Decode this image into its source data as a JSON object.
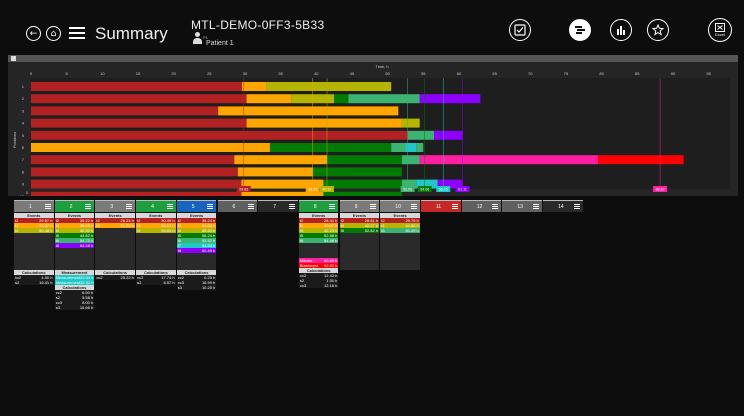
{
  "header": {
    "title": "Summary",
    "device_id": "MTL-DEMO-0FF3-5B33",
    "patient_id": "P1",
    "patient_name": "Patient 1",
    "excel_label": "Excel"
  },
  "colors": {
    "red": "#b22222",
    "orange": "#ffa500",
    "olive": "#b5b400",
    "darkgreen": "#007a00",
    "seagreen": "#3cb371",
    "teal": "#1fc8c8",
    "violet": "#8b00ff",
    "pink": "#ff1fa0",
    "brightred": "#ff0000",
    "blue": "#1565c0"
  },
  "chart_data": {
    "type": "bar",
    "title": "Time, h",
    "xlabel": "Time, h",
    "ylabel": "Positions",
    "xlim": [
      0,
      98
    ],
    "xticks": [
      0,
      5,
      10,
      15,
      20,
      25,
      30,
      35,
      40,
      45,
      50,
      55,
      60,
      65,
      70,
      75,
      80,
      85,
      90,
      95
    ],
    "categories": [
      "1",
      "2",
      "3",
      "4",
      "5",
      "6",
      "7",
      "8",
      "9",
      "10",
      "11",
      "12",
      "13",
      "14"
    ],
    "rows": [
      {
        "position": "1",
        "segments": [
          {
            "start": 0,
            "end": 29.57,
            "color": "red"
          },
          {
            "start": 29.57,
            "end": 33,
            "color": "orange"
          },
          {
            "start": 33,
            "end": 50.5,
            "color": "olive"
          }
        ]
      },
      {
        "position": "2",
        "segments": [
          {
            "start": 0,
            "end": 30.22,
            "color": "red"
          },
          {
            "start": 30.22,
            "end": 36.5,
            "color": "orange"
          },
          {
            "start": 36.5,
            "end": 42.5,
            "color": "olive"
          },
          {
            "start": 42.5,
            "end": 44.5,
            "color": "darkgreen"
          },
          {
            "start": 44.5,
            "end": 54.5,
            "color": "seagreen"
          },
          {
            "start": 54.5,
            "end": 63,
            "color": "violet"
          }
        ]
      },
      {
        "position": "3",
        "segments": [
          {
            "start": 0,
            "end": 26.24,
            "color": "red"
          },
          {
            "start": 26.24,
            "end": 51.5,
            "color": "orange"
          }
        ]
      },
      {
        "position": "4",
        "segments": [
          {
            "start": 0,
            "end": 30.22,
            "color": "red"
          },
          {
            "start": 30.22,
            "end": 52,
            "color": "orange"
          },
          {
            "start": 52,
            "end": 54.5,
            "color": "olive"
          }
        ]
      },
      {
        "position": "5",
        "segments": [
          {
            "start": 0,
            "end": 52.8,
            "color": "red"
          },
          {
            "start": 52.8,
            "end": 56.5,
            "color": "seagreen"
          },
          {
            "start": 56.5,
            "end": 60.5,
            "color": "violet"
          }
        ]
      },
      {
        "position": "6",
        "segments": [
          {
            "start": 0,
            "end": 33.5,
            "color": "orange"
          },
          {
            "start": 33.5,
            "end": 42,
            "color": "darkgreen"
          },
          {
            "start": 42,
            "end": 50.5,
            "color": "darkgreen"
          },
          {
            "start": 50.5,
            "end": 52.5,
            "color": "seagreen"
          },
          {
            "start": 52.5,
            "end": 54,
            "color": "teal"
          },
          {
            "start": 54,
            "end": 55,
            "color": "seagreen"
          }
        ]
      },
      {
        "position": "7",
        "segments": [
          {
            "start": 0,
            "end": 28.5,
            "color": "red"
          },
          {
            "start": 28.5,
            "end": 41.5,
            "color": "orange"
          },
          {
            "start": 41.5,
            "end": 52,
            "color": "darkgreen"
          },
          {
            "start": 52,
            "end": 54.5,
            "color": "seagreen"
          },
          {
            "start": 54.5,
            "end": 79.5,
            "color": "pink"
          },
          {
            "start": 79.5,
            "end": 91.5,
            "color": "brightred"
          }
        ]
      },
      {
        "position": "8",
        "segments": [
          {
            "start": 0,
            "end": 29.0,
            "color": "red"
          },
          {
            "start": 29.0,
            "end": 39.5,
            "color": "orange"
          },
          {
            "start": 39.5,
            "end": 52,
            "color": "darkgreen"
          }
        ]
      },
      {
        "position": "9",
        "segments": [
          {
            "start": 0,
            "end": 29.5,
            "color": "red"
          },
          {
            "start": 29.5,
            "end": 41,
            "color": "orange"
          },
          {
            "start": 41,
            "end": 52,
            "color": "darkgreen"
          },
          {
            "start": 52,
            "end": 54,
            "color": "seagreen"
          },
          {
            "start": 54,
            "end": 57,
            "color": "teal"
          },
          {
            "start": 57,
            "end": 60.5,
            "color": "violet"
          }
        ]
      },
      {
        "position": "10",
        "segments": [
          {
            "start": 0,
            "end": 29.5,
            "color": "red"
          },
          {
            "start": 29.5,
            "end": 41,
            "color": "orange"
          },
          {
            "start": 41,
            "end": 52,
            "color": "darkgreen"
          }
        ]
      }
    ],
    "markers": [
      {
        "x": 29.83,
        "label": "29.83",
        "color": "red"
      },
      {
        "x": 39.5,
        "label": "38.25",
        "color": "orange"
      },
      {
        "x": 41.5,
        "label": "40.17",
        "color": "olive"
      },
      {
        "x": 52.8,
        "label": "53.00",
        "color": "seagreen"
      },
      {
        "x": 55.2,
        "label": "54.06",
        "color": "darkgreen"
      },
      {
        "x": 57.8,
        "label": "56.75",
        "color": "teal"
      },
      {
        "x": 60.5,
        "label": "61.11",
        "color": "violet"
      },
      {
        "x": 88.2,
        "label": "88.82",
        "color": "pink"
      }
    ]
  },
  "positions": [
    {
      "num": "1",
      "color": "#7a7a7a"
    },
    {
      "num": "2",
      "color": "#1e9e3e"
    },
    {
      "num": "3",
      "color": "#7a7a7a"
    },
    {
      "num": "4",
      "color": "#1e9e3e"
    },
    {
      "num": "5",
      "color": "#1565c0"
    },
    {
      "num": "6",
      "color": "#606060"
    },
    {
      "num": "7",
      "color": "#2a2a2a"
    },
    {
      "num": "8",
      "color": "#1e9e3e"
    },
    {
      "num": "9",
      "color": "#7a7a7a"
    },
    {
      "num": "10",
      "color": "#7a7a7a"
    },
    {
      "num": "11",
      "color": "#c62828"
    },
    {
      "num": "12",
      "color": "#606060"
    },
    {
      "num": "13",
      "color": "#606060"
    },
    {
      "num": "14",
      "color": "#2a2a2a"
    }
  ],
  "panels": [
    {
      "pos": "1",
      "events": [
        [
          "t2",
          "29.57 h",
          "red"
        ],
        [
          "t3",
          "33.37 h",
          "orange"
        ],
        [
          "t4",
          "50.48 h",
          "olive"
        ]
      ],
      "calcs": [
        [
          "cc2",
          "4.50 h"
        ],
        [
          "s2",
          "16.41 h"
        ]
      ]
    },
    {
      "pos": "2",
      "events": [
        [
          "t2",
          "30.22 h",
          "red"
        ],
        [
          "t3",
          "36.63 h",
          "orange"
        ],
        [
          "t4",
          "40.20 h",
          "olive"
        ],
        [
          "t5",
          "44.82 h",
          "darkgreen"
        ],
        [
          "t6",
          "54.73 h",
          "seagreen"
        ],
        [
          "t8",
          "64.48 h",
          "violet"
        ]
      ],
      "measure": [
        [
          "Measurement",
          "22.44 h"
        ],
        [
          "Measurement",
          "32.32 h"
        ]
      ],
      "calcs": [
        [
          "cc2",
          "6.50 h"
        ],
        [
          "s2",
          "5.58 h"
        ],
        [
          "cc3",
          "8.00 h"
        ],
        [
          "s3",
          "10.66 h"
        ]
      ]
    },
    {
      "pos": "3",
      "events": [
        [
          "t2",
          "26.24 h",
          "red"
        ],
        [
          "t3",
          "51.22 h",
          "orange"
        ]
      ],
      "calcs": [
        [
          "cc2",
          "25.22 h"
        ]
      ]
    },
    {
      "pos": "4",
      "events": [
        [
          "t2",
          "30.49 h",
          "red"
        ],
        [
          "t3",
          "56.13 h",
          "orange"
        ],
        [
          "t4",
          "54.93 h",
          "olive"
        ]
      ],
      "calcs": [
        [
          "cc2",
          "17.74 h"
        ],
        [
          "s2",
          "6.57 h"
        ]
      ]
    },
    {
      "pos": "5",
      "events": [
        [
          "t2",
          "35.24 h",
          "red"
        ],
        [
          "t3",
          "53.00 h",
          "orange"
        ],
        [
          "t4",
          "55.83 h",
          "olive"
        ],
        [
          "t5",
          "56.24 h",
          "darkgreen"
        ],
        [
          "t6",
          "53.52 h",
          "seagreen"
        ],
        [
          "t7",
          "54.83 h",
          "teal"
        ],
        [
          "t8",
          "60.49 h",
          "violet"
        ]
      ],
      "calcs": [
        [
          "cc2",
          "0.25 h"
        ],
        [
          "cc3",
          "16.99 h"
        ],
        [
          "s3",
          "10.25 h"
        ]
      ]
    },
    {
      "pos": "8",
      "events": [
        [
          "t2",
          "28.41 h",
          "red"
        ],
        [
          "t3",
          "40.07 h",
          "orange"
        ],
        [
          "t4",
          "42.23 h",
          "olive"
        ],
        [
          "t5",
          "52.88 h",
          "darkgreen"
        ],
        [
          "t6",
          "54.48 h",
          "seagreen"
        ]
      ],
      "extra": [
        [
          "Mitosis",
          "80.85 h",
          "pink"
        ],
        [
          "Blastocyst",
          "92.82 h",
          "brightred"
        ]
      ],
      "calcs": [
        [
          "cc2",
          "12.42 h"
        ],
        [
          "s2",
          "1.50 h"
        ],
        [
          "cc3",
          "12.16 h"
        ]
      ]
    },
    {
      "pos": "9",
      "events": [
        [
          "t2",
          "28.81 h",
          "red"
        ],
        [
          "t4",
          "40.27 h",
          "olive"
        ],
        [
          "t5",
          "52.82 h",
          "darkgreen"
        ]
      ]
    },
    {
      "pos": "10",
      "events": [
        [
          "t2",
          "29.75 h",
          "red"
        ],
        [
          "t4",
          "44.86 h",
          "olive"
        ],
        [
          "t8",
          "60.49 h",
          "seagreen"
        ]
      ]
    }
  ],
  "labels": {
    "events": "Events",
    "calculations": "Calculations",
    "measurement": "Measurement"
  }
}
